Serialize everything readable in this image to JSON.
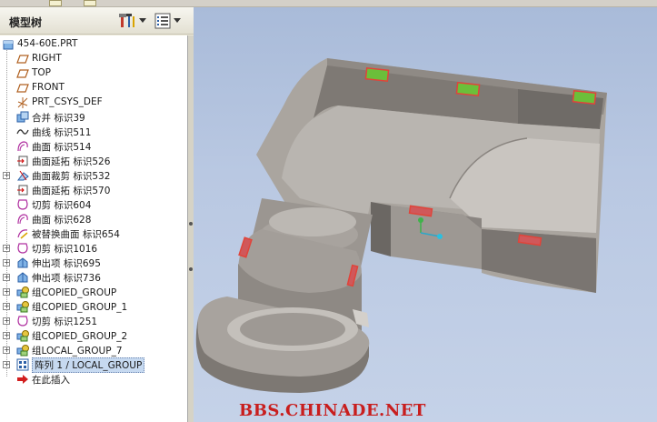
{
  "panel": {
    "title": "模型树"
  },
  "tree": {
    "items": [
      {
        "label": "454-60E.PRT",
        "icon": "part-icon"
      },
      {
        "label": "RIGHT",
        "icon": "datum-plane-icon"
      },
      {
        "label": "TOP",
        "icon": "datum-plane-icon"
      },
      {
        "label": "FRONT",
        "icon": "datum-plane-icon"
      },
      {
        "label": "PRT_CSYS_DEF",
        "icon": "csys-icon"
      },
      {
        "label": "合并 标识39",
        "icon": "merge-icon"
      },
      {
        "label": "曲线 标识511",
        "icon": "curve-icon"
      },
      {
        "label": "曲面 标识514",
        "icon": "surface-icon"
      },
      {
        "label": "曲面延拓 标识526",
        "icon": "surface-extend-icon"
      },
      {
        "label": "曲面裁剪 标识532",
        "icon": "surface-trim-icon"
      },
      {
        "label": "曲面延拓 标识570",
        "icon": "surface-extend-icon"
      },
      {
        "label": "切剪 标识604",
        "icon": "cut-icon"
      },
      {
        "label": "曲面 标识628",
        "icon": "surface-icon"
      },
      {
        "label": "被替换曲面 标识654",
        "icon": "replaced-surface-icon"
      },
      {
        "label": "切剪 标识1016",
        "icon": "cut-icon"
      },
      {
        "label": "伸出项 标识695",
        "icon": "protrusion-icon"
      },
      {
        "label": "伸出项 标识736",
        "icon": "protrusion-icon"
      },
      {
        "label": "组COPIED_GROUP",
        "icon": "group-icon"
      },
      {
        "label": "组COPIED_GROUP_1",
        "icon": "group-icon"
      },
      {
        "label": "切剪 标识1251",
        "icon": "cut-icon"
      },
      {
        "label": "组COPIED_GROUP_2",
        "icon": "group-icon"
      },
      {
        "label": "组LOCAL_GROUP_7",
        "icon": "group-icon"
      },
      {
        "label": "阵列 1 / LOCAL_GROUP",
        "icon": "pattern-icon"
      },
      {
        "label": "在此插入",
        "icon": "insert-arrow-icon"
      }
    ]
  },
  "watermark": "BBS.CHINADE.NET",
  "colors": {
    "viewport_bg": "#b9c8e2",
    "model_gray": "#9e9994",
    "highlight_red": "#e0443a",
    "highlight_green": "#6bbf3a",
    "watermark": "#c81e1e"
  }
}
